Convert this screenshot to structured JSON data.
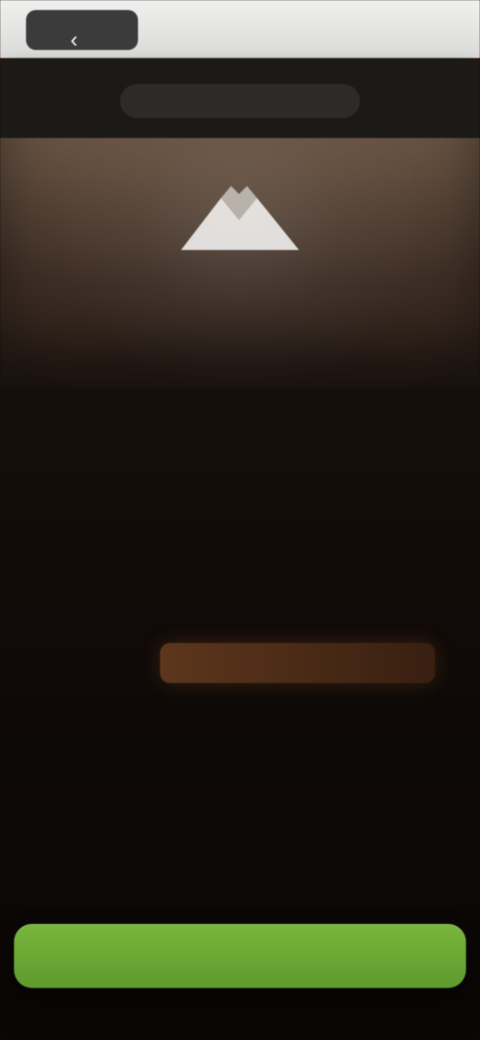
{
  "os_bar": {
    "back_icon": "chevron-left-icon",
    "back_glyph": "‹"
  },
  "header": {
    "title": ""
  },
  "hero": {
    "brand": "",
    "subtitle": ""
  },
  "content": {
    "heading": "",
    "paragraph": "",
    "list_items": [
      "",
      "",
      "",
      ""
    ],
    "cta_label": ""
  },
  "colors": {
    "accent_green": "#54c53d",
    "cta_green": "#78b63b",
    "accent_orange": "#d07b33"
  }
}
